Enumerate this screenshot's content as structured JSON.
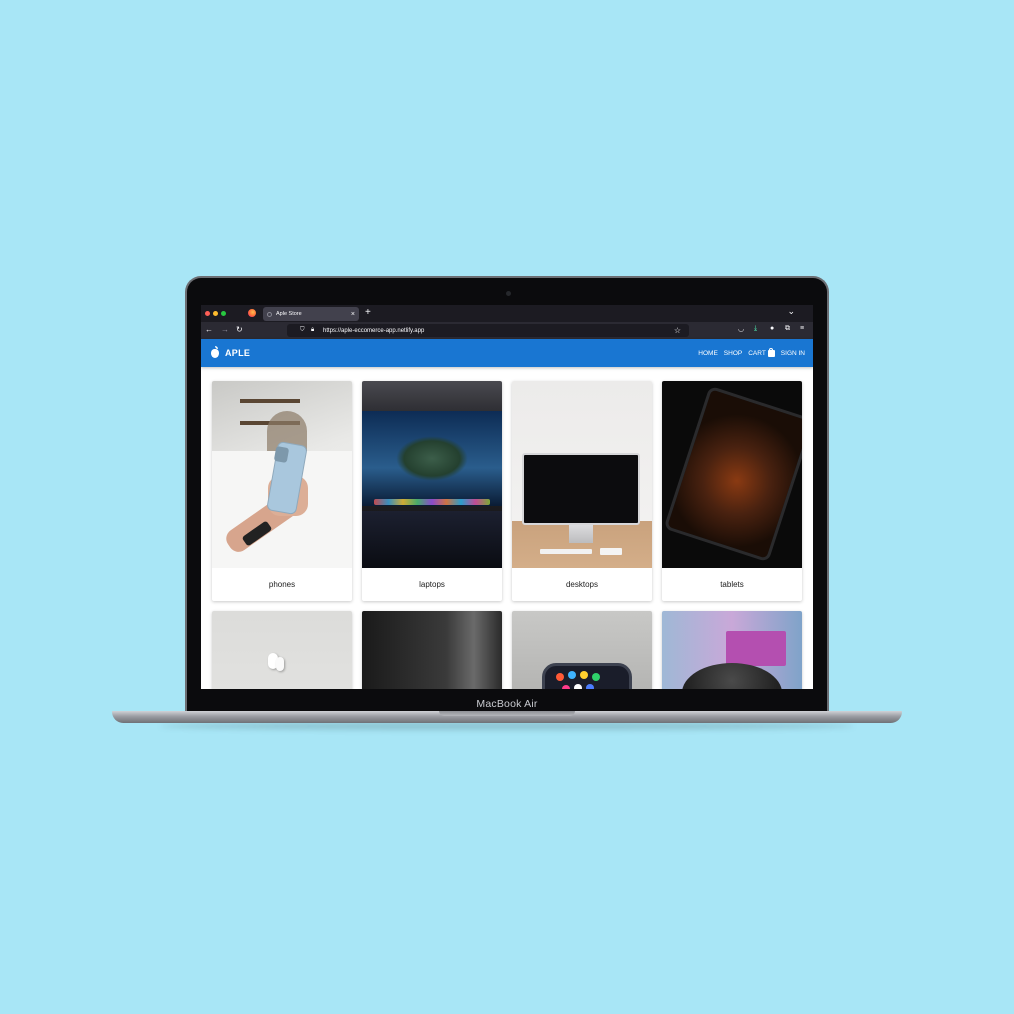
{
  "device": {
    "label": "MacBook Air"
  },
  "browser": {
    "tab_title": "Aple Store",
    "url": "https://aple-eccomerce-app.netlify.app",
    "new_tab_label": "+",
    "tab_close_label": "×"
  },
  "site": {
    "brand": "APLE",
    "accent_color": "#1976d2",
    "menu": {
      "home": "HOME",
      "shop": "SHOP",
      "cart": "CART",
      "sign_in": "SIGN IN"
    },
    "categories": [
      {
        "title": "phones"
      },
      {
        "title": "laptops"
      },
      {
        "title": "desktops"
      },
      {
        "title": "tablets"
      }
    ]
  },
  "icons": {
    "back": "arrow-left-icon",
    "forward": "arrow-right-icon",
    "reload": "reload-icon",
    "shield": "shield-icon",
    "lock": "lock-icon",
    "bookmark": "star-icon",
    "pocket": "pocket-icon",
    "downloads": "download-icon",
    "account": "account-icon",
    "extensions": "puzzle-icon",
    "menu": "hamburger-icon",
    "cart": "shopping-bag-icon",
    "logo": "apple-logo-icon"
  }
}
